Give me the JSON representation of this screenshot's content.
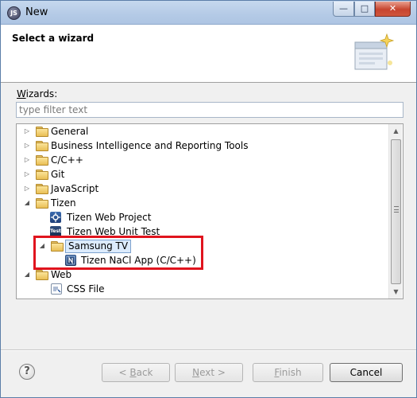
{
  "window": {
    "title": "New",
    "app_icon_text": "JS"
  },
  "title_controls": {
    "minimize": "—",
    "maximize": "□",
    "close": "✕"
  },
  "banner": {
    "title": "Select a wizard",
    "icon": "wizard-banner-icon"
  },
  "wizards": {
    "label_underlined": "W",
    "label_rest": "izards:",
    "filter_placeholder": "type filter text",
    "filter_value": ""
  },
  "tree": {
    "items": [
      {
        "label": "General",
        "expanded": false,
        "icon": "folder-icon"
      },
      {
        "label": "Business Intelligence and Reporting Tools",
        "expanded": false,
        "icon": "folder-icon"
      },
      {
        "label": "C/C++",
        "expanded": false,
        "icon": "folder-icon"
      },
      {
        "label": "Git",
        "expanded": false,
        "icon": "folder-icon"
      },
      {
        "label": "JavaScript",
        "expanded": false,
        "icon": "folder-icon"
      },
      {
        "label": "Tizen",
        "expanded": true,
        "icon": "folder-open-icon"
      },
      {
        "label": "Tizen Web Project",
        "icon": "tizen-web-project-icon",
        "icon_text": ""
      },
      {
        "label": "Tizen Web Unit Test",
        "icon": "tizen-test-icon",
        "icon_text": "Test"
      },
      {
        "label": "Samsung TV",
        "expanded": true,
        "icon": "folder-open-icon",
        "selected": true
      },
      {
        "label": "Tizen NaCl App (C/C++)",
        "icon": "tizen-nacl-app-icon"
      },
      {
        "label": "Web",
        "expanded": true,
        "icon": "folder-open-icon"
      },
      {
        "label": "CSS File",
        "icon": "css-file-icon"
      }
    ]
  },
  "footer": {
    "help": "?",
    "back_underlined": "B",
    "back_prefix": "< ",
    "back_rest": "ack",
    "next_underlined": "N",
    "next_rest": "ext >",
    "finish_underlined": "F",
    "finish_rest": "inish",
    "cancel": "Cancel"
  },
  "colors": {
    "highlight_box": "#e0141e",
    "selection": "#dcebfc"
  }
}
